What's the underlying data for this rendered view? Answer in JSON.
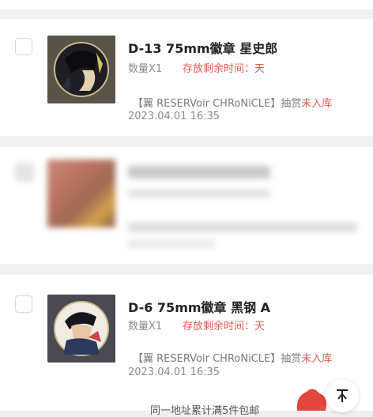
{
  "items": [
    {
      "title": "D-13 75mm徽章 星史郎",
      "quantity": "数量X1",
      "storage_label": "存放剩余时间：天",
      "source_prefix": "【翼 RESERVoir CHRoNiCLE】抽赏",
      "source_status": "未入库",
      "date": "2023.04.01 16:35",
      "thumb_icon": "anime-badge-image"
    },
    {
      "title": "D-6 75mm徽章 黑钢 A",
      "quantity": "数量X1",
      "storage_label": "存放剩余时间：天",
      "source_prefix": "【翼 RESERVoir CHRoNiCLE】抽赏",
      "source_status": "未入库",
      "date": "2023.04.01 16:35",
      "thumb_icon": "anime-badge-image"
    }
  ],
  "footer": {
    "text": "同一地址累计满5件包邮"
  },
  "fab_icon": "scroll-top-icon",
  "colors": {
    "accent": "#e8594f",
    "background": "#f1eff1"
  }
}
